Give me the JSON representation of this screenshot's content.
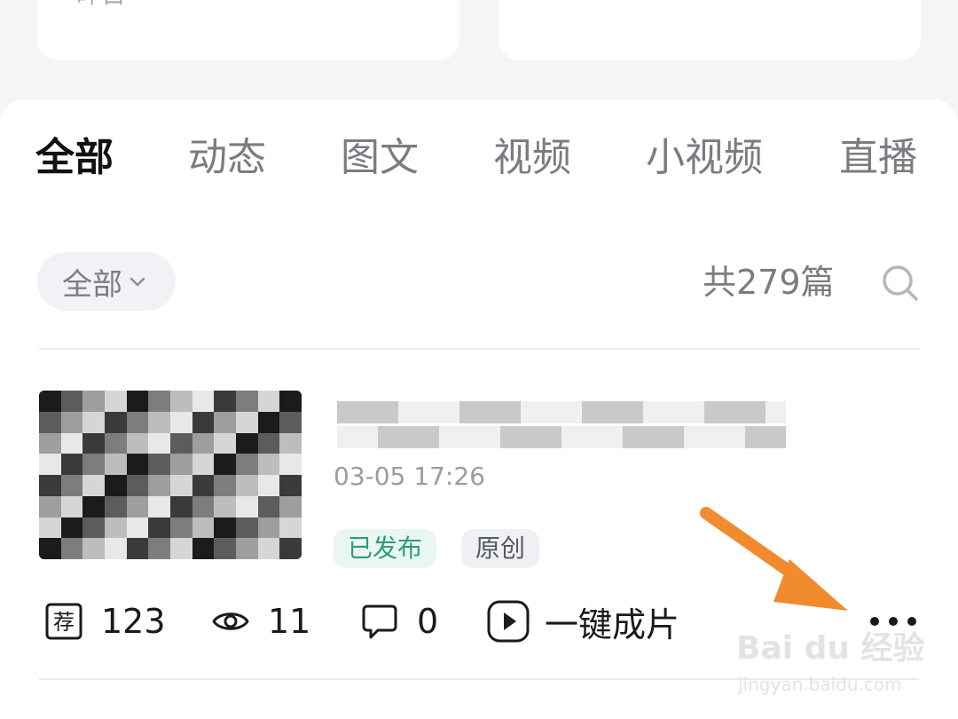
{
  "stats": {
    "yesterday_label": "昨日 - -"
  },
  "tabs": [
    {
      "label": "全部",
      "active": true
    },
    {
      "label": "动态",
      "active": false
    },
    {
      "label": "图文",
      "active": false
    },
    {
      "label": "视频",
      "active": false
    },
    {
      "label": "小视频",
      "active": false
    },
    {
      "label": "直播",
      "active": false
    }
  ],
  "filter": {
    "label": "全部"
  },
  "count_text": "共279篇",
  "post": {
    "time": "03-05 17:26",
    "tags": {
      "published": "已发布",
      "original": "原创"
    },
    "metrics": {
      "recommend": "123",
      "views": "11",
      "comments": "0",
      "one_click_video": "一键成片"
    }
  },
  "icons": {
    "chevron": "chevron-down-icon",
    "search": "search-icon",
    "recommend": "recommend-badge-icon",
    "views": "eye-icon",
    "comments": "comment-bubble-icon",
    "video": "play-icon",
    "more": "more-dots-icon"
  },
  "watermark": {
    "brand": "Bai du 经验",
    "url": "jingyan.baidu.com"
  },
  "colors": {
    "accent_green": "#2b9c79",
    "annotation_arrow": "#f28a2e",
    "text_primary": "#111111",
    "text_secondary": "#7a7c80"
  }
}
